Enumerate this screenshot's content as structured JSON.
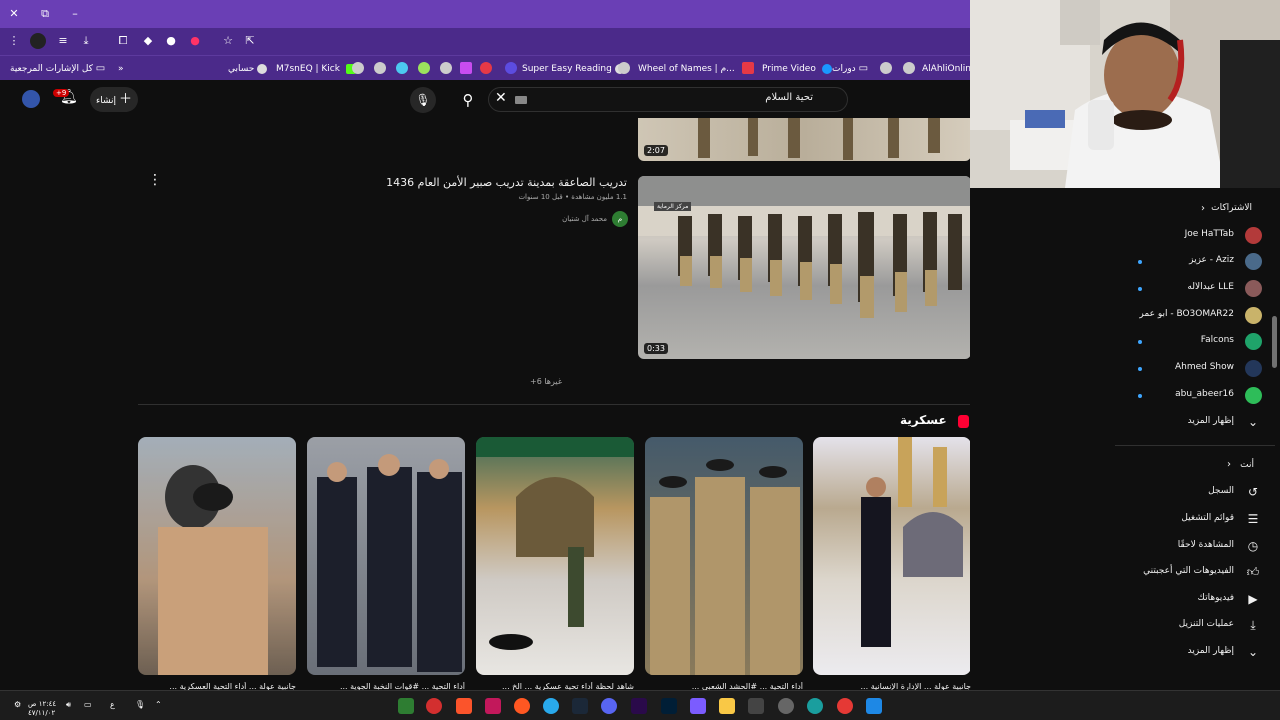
{
  "bookmarks": {
    "all_label": "كل الإشارات المرجعية",
    "items": [
      "حسابي",
      "M7snEQ | Kick",
      "Super Easy Reading",
      "Wheel of Names | م...",
      "Prime Video",
      "دورات",
      "AlAhliOnline"
    ]
  },
  "header": {
    "search_value": "تحية السلام",
    "create_label": "إنشاء",
    "notif_badge": "+9"
  },
  "videos": [
    {
      "duration": "2:07"
    },
    {
      "title": "تدريب الصاعقة بمدينة تدريب صبير الأمن العام 1436",
      "meta": "1.1 مليون مشاهدة • قبل 10 سنوات",
      "channel": "محمد آل شتيان",
      "duration": "0:33",
      "overlay": "مركز الرماية"
    }
  ],
  "more_link": "+6 غيرها",
  "shelf": {
    "title": "عسكرية",
    "shorts": [
      "جانبية عولة ... الإدارة الإنسانية ...",
      "أداء التحية ... #الحشد الشعبي ...",
      "شاهد لحظة أداء تحية عسكرية ... الخ ...",
      "أداء التحية ... #قوات النخبة الجوية ...",
      "جانبية عولة ... أداء التحية العسكرية ..."
    ]
  },
  "sidebar": {
    "subs_heading": "الاشتراكات",
    "subs": [
      "Joe HaTTab",
      "عزيز - Aziz",
      "عبدالاله LLE",
      "ابو عمر - BO3OMAR22",
      "Falcons",
      "Ahmed Show",
      "abu_abeer16"
    ],
    "show_more": "إظهار المزيد",
    "you_heading": "أنت",
    "you_items": [
      "السجل",
      "قوائم التشغيل",
      "المشاهدة لاحقًا",
      "الفيديوهات التي أعجبتني",
      "فيديوهاتك",
      "عمليات التنزيل",
      "إظهار المزيد"
    ]
  },
  "taskbar": {
    "time": "١٢:٤٤ ص",
    "date": "٤٧/١١/٠٢",
    "lang": "ع"
  },
  "colors": {
    "accent": "#6a3fb5",
    "yt_red": "#ff0033",
    "bg": "#0f0f0f"
  }
}
